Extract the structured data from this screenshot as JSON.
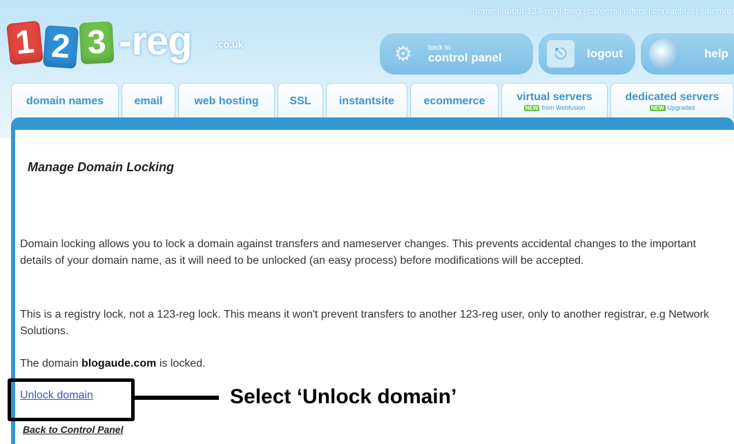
{
  "top_links": [
    "home",
    "about 123-reg",
    "blog",
    "careers",
    "offers",
    "contact us",
    "site map"
  ],
  "logo": {
    "digit1": "1",
    "digit2": "2",
    "digit3": "3",
    "word": "-reg",
    "tld": ".co.uk"
  },
  "header_buttons": {
    "control_panel_small": "back to",
    "control_panel_big": "control panel",
    "logout": "logout",
    "help": "help"
  },
  "tabs": [
    {
      "label": "domain names"
    },
    {
      "label": "email"
    },
    {
      "label": "web hosting"
    },
    {
      "label": "SSL"
    },
    {
      "label": "instantsite"
    },
    {
      "label": "ecommerce"
    },
    {
      "label": "virtual servers",
      "badge": "NEW",
      "sub": "from Webfusion"
    },
    {
      "label": "dedicated servers",
      "badge": "NEW",
      "sub": "Upgraded"
    }
  ],
  "main": {
    "title": "Manage Domain Locking",
    "para1": "Domain locking allows you to lock a domain against transfers and nameserver changes. This prevents accidental changes to the important details of your domain name, as it will need to be unlocked (an easy process) before modifications will be accepted.",
    "para2": "This is a registry lock, not a 123-reg lock. This means it won't prevent transfers to another 123-reg user, only to another registrar, e.g Network Solutions.",
    "status_prefix": "The domain ",
    "domain": "blogaude.com",
    "status_suffix": " is locked.",
    "unlock_link": "Unlock domain",
    "back_link": "Back to Control Panel"
  },
  "annotation": {
    "callout": "Select ‘Unlock domain’"
  },
  "colors": {
    "accent": "#3497d3",
    "tab_text": "#3f93c8",
    "badge": "#6cbf3e"
  }
}
